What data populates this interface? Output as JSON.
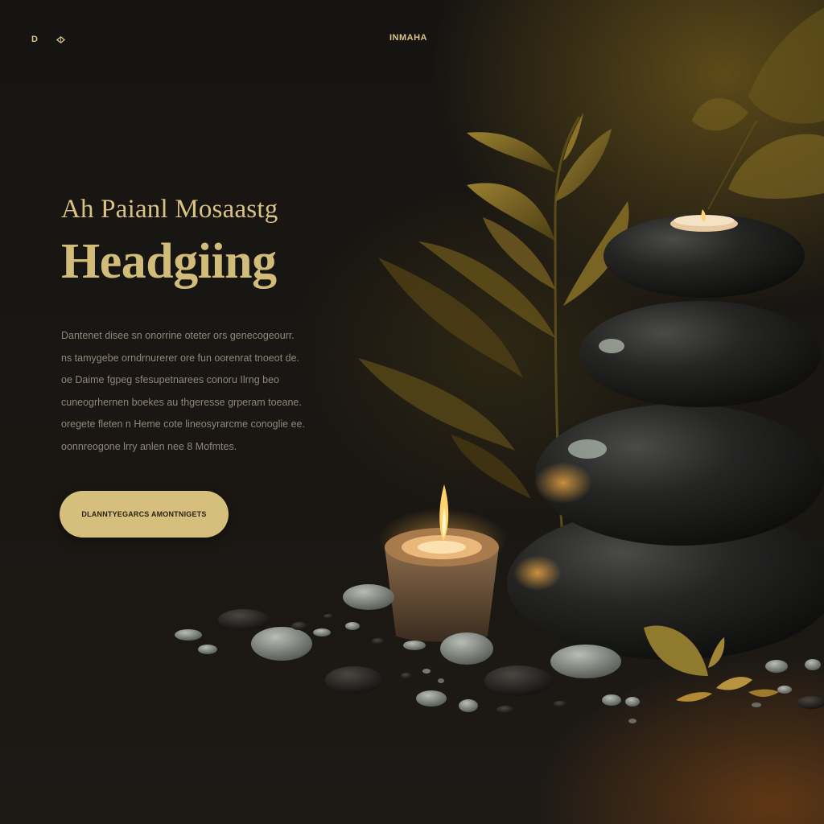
{
  "nav": {
    "left_label": "D",
    "left_icon": "leaf-icon"
  },
  "brand": {
    "name": "INMAHA"
  },
  "hero": {
    "subtitle": "Ah Paianl Mosaastg",
    "title": "Headgiing",
    "body_lines": [
      "Dantenet disee sn onorrine oteter ors genecogeourr.",
      "ns tamygebe orndrnurerer ore fun oorenrat tnoeot de.",
      "oe Daime fgpeg sfesupetnarees conoru Ilrng beo",
      "cuneogrhernen boekes au thgeresse grperam toeane.",
      "oregete fleten n Heme cote lineosyrarcme conoglie ee.",
      "oonnreogone lrry anlen nee 8 Mofmtes."
    ],
    "cta_label": "DLANNTYEGARCS AMONTNIGETS"
  },
  "colors": {
    "accent": "#d6bf7d",
    "background": "#161412",
    "body_text": "#8f877a"
  }
}
